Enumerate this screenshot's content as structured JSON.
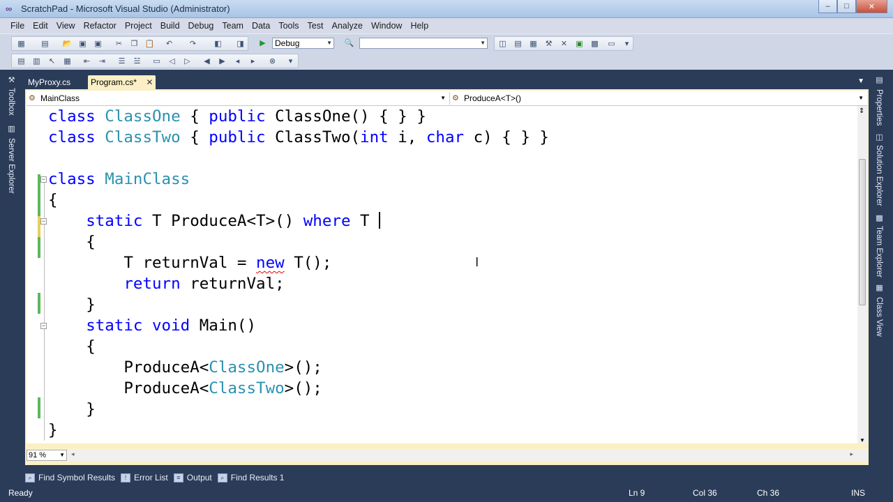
{
  "window": {
    "title": "ScratchPad - Microsoft Visual Studio (Administrator)",
    "minimize": "–",
    "maximize": "□",
    "close": "✕"
  },
  "menu": [
    "File",
    "Edit",
    "View",
    "Refactor",
    "Project",
    "Build",
    "Debug",
    "Team",
    "Data",
    "Tools",
    "Test",
    "Analyze",
    "Window",
    "Help"
  ],
  "toolbar": {
    "config_value": "Debug",
    "platform_value": ""
  },
  "side_left": {
    "toolbox": "Toolbox",
    "server_explorer": "Server Explorer"
  },
  "side_right": {
    "properties": "Properties",
    "solution_explorer": "Solution Explorer",
    "team_explorer": "Team Explorer",
    "class_view": "Class View"
  },
  "doc_tabs": [
    {
      "label": "MyProxy.cs",
      "active": false
    },
    {
      "label": "Program.cs*",
      "active": true,
      "close": "✕"
    }
  ],
  "navbar": {
    "type_combo": "MainClass",
    "member_combo": "ProduceA<T>()"
  },
  "zoom": "91 %",
  "bottom_tabs": [
    "Find Symbol Results",
    "Error List",
    "Output",
    "Find Results 1"
  ],
  "status": {
    "state": "Ready",
    "ln": "Ln 9",
    "col": "Col 36",
    "ch": "Ch 36",
    "mode": "INS"
  },
  "colors": {
    "keyword": "#0000ff",
    "type": "#2b91af",
    "chrome": "#2b3c59",
    "tab_active": "#fbf0c5"
  },
  "code": {
    "l1": {
      "k1": "class",
      "t1": "ClassOne",
      "s1": " { ",
      "k2": "public",
      "s2": " ClassOne() { } }"
    },
    "l2": {
      "k1": "class",
      "t1": "ClassTwo",
      "s1": " { ",
      "k2": "public",
      "s2": " ClassTwo(",
      "k3": "int",
      "s3": " i, ",
      "k4": "char",
      "s4": " c) { } }"
    },
    "l4": {
      "k1": "class",
      "t1": "MainClass"
    },
    "l5": "{",
    "l6": {
      "k1": "static",
      "s1": " T ProduceA<T>() ",
      "k2": "where",
      "s2": " T "
    },
    "l7": "{",
    "l8": {
      "s1": "T returnVal = ",
      "k1": "new",
      "s2": " T();"
    },
    "l9": {
      "k1": "return",
      "s1": " returnVal;"
    },
    "l10": "}",
    "l11": {
      "k1": "static",
      "s1": " ",
      "k2": "void",
      "s2": " Main()"
    },
    "l12": "{",
    "l13": {
      "s1": "ProduceA<",
      "t1": "ClassOne",
      "s2": ">();"
    },
    "l14": {
      "s1": "ProduceA<",
      "t1": "ClassTwo",
      "s2": ">();"
    },
    "l15": "}",
    "l16": "}"
  }
}
